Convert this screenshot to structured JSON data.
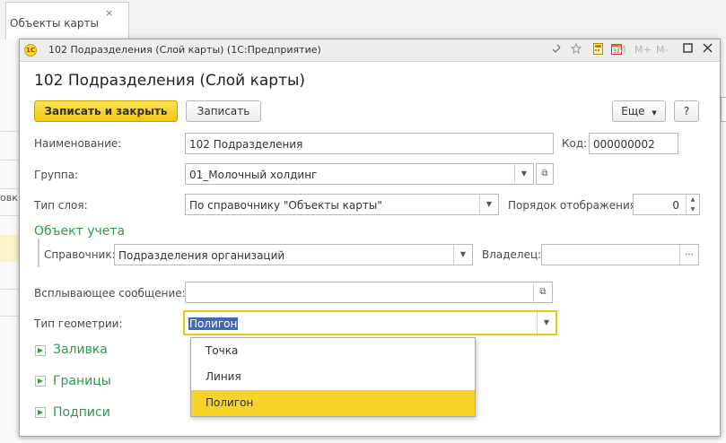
{
  "background": {
    "tab_title": "Объекты карты",
    "tab_close": "×",
    "row_cut_text": "овк"
  },
  "window": {
    "title": "102 Подразделения (Слой карты)  (1С:Предприятие)",
    "logo_text": "1С",
    "toolbar": {
      "m_label": "M",
      "m_plus_label": "M+",
      "m_minus_label": "M-"
    }
  },
  "form": {
    "heading": "102 Подразделения (Слой карты)",
    "save_close_label": "Записать и закрыть",
    "save_label": "Записать",
    "more_label": "Еще",
    "help_label": "?",
    "name_label": "Наименование:",
    "name_value": "102 Подразделения",
    "code_label": "Код:",
    "code_value": "000000002",
    "group_label": "Группа:",
    "group_value": "01_Молочный холдинг",
    "layer_type_label": "Тип слоя:",
    "layer_type_value": "По справочнику \"Объекты карты\"",
    "display_order_label": "Порядок отображения:",
    "display_order_value": "0",
    "accounting_object_header": "Объект учета",
    "catalog_label": "Справочник:",
    "catalog_value": "Подразделения организаций",
    "owner_label": "Владелец:",
    "owner_value": "",
    "owner_select": "...",
    "popup_message_label": "Всплывающее сообщение:",
    "popup_message_value": "",
    "geometry_type_label": "Тип геометрии:",
    "geometry_type_value": "Полигон",
    "geometry_options": [
      "Точка",
      "Линия",
      "Полигон"
    ],
    "fill_section": "Заливка",
    "borders_section": "Границы",
    "captions_section": "Подписи"
  },
  "colors": {
    "accent_yellow": "#f5d427",
    "section_green": "#2f9a4a",
    "selection_blue": "#3f6ab8"
  }
}
